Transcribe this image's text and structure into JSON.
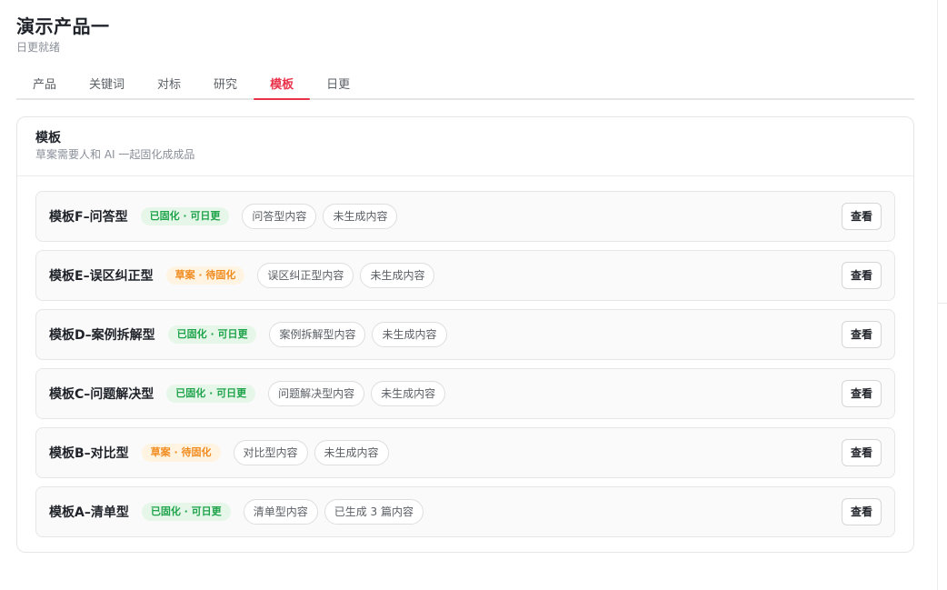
{
  "header": {
    "title": "演示产品一",
    "subtitle": "日更就绪"
  },
  "tabs": [
    {
      "label": "产品",
      "active": false
    },
    {
      "label": "关键词",
      "active": false
    },
    {
      "label": "对标",
      "active": false
    },
    {
      "label": "研究",
      "active": false
    },
    {
      "label": "模板",
      "active": true
    },
    {
      "label": "日更",
      "active": false
    }
  ],
  "panel": {
    "title": "模板",
    "subtitle": "草案需要人和 AI 一起固化成成品"
  },
  "colors": {
    "accent": "#e8334a",
    "badge_green_text": "#1ea34a",
    "badge_green_bg": "#e6f7ea",
    "badge_orange_text": "#f08a1c",
    "badge_orange_bg": "#fff4e2"
  },
  "templates": [
    {
      "name": "模板F–问答型",
      "status": "已固化 · 可日更",
      "status_type": "green",
      "content_type": "问答型内容",
      "progress": "未生成内容",
      "action": "查看"
    },
    {
      "name": "模板E–误区纠正型",
      "status": "草案 · 待固化",
      "status_type": "orange",
      "content_type": "误区纠正型内容",
      "progress": "未生成内容",
      "action": "查看"
    },
    {
      "name": "模板D–案例拆解型",
      "status": "已固化 · 可日更",
      "status_type": "green",
      "content_type": "案例拆解型内容",
      "progress": "未生成内容",
      "action": "查看"
    },
    {
      "name": "模板C–问题解决型",
      "status": "已固化 · 可日更",
      "status_type": "green",
      "content_type": "问题解决型内容",
      "progress": "未生成内容",
      "action": "查看"
    },
    {
      "name": "模板B–对比型",
      "status": "草案 · 待固化",
      "status_type": "orange",
      "content_type": "对比型内容",
      "progress": "未生成内容",
      "action": "查看"
    },
    {
      "name": "模板A–清单型",
      "status": "已固化 · 可日更",
      "status_type": "green",
      "content_type": "清单型内容",
      "progress": "已生成 3 篇内容",
      "action": "查看"
    }
  ]
}
